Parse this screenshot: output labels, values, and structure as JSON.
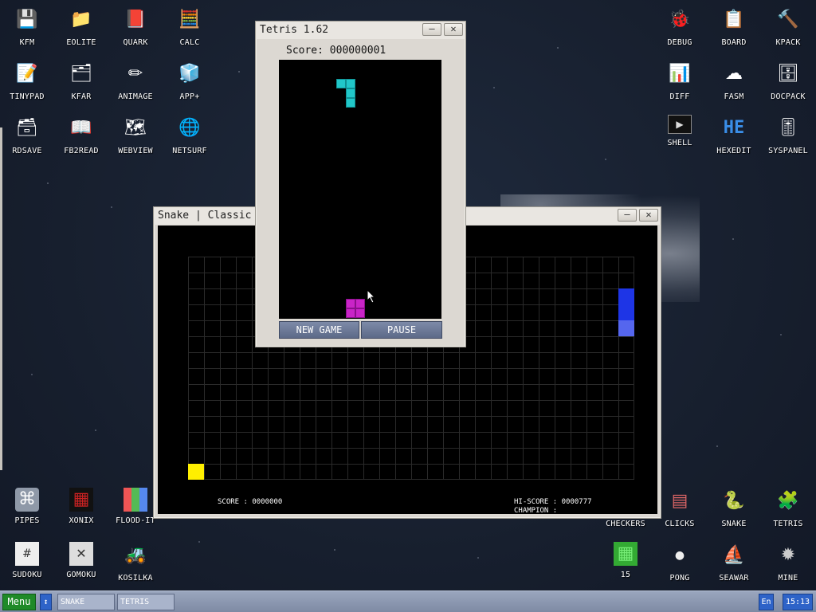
{
  "desktop_icons": [
    {
      "label": "KFM",
      "icon": "floppy-icon",
      "glyph": "💾"
    },
    {
      "label": "EOLITE",
      "icon": "folder-icon",
      "glyph": "📁"
    },
    {
      "label": "QUARK",
      "icon": "notebook-icon",
      "glyph": "📕"
    },
    {
      "label": "CALC",
      "icon": "calculator-icon",
      "glyph": "🧮"
    },
    {
      "label": "TINYPAD",
      "icon": "notepad-icon",
      "glyph": "📝"
    },
    {
      "label": "KFAR",
      "icon": "file-manager-icon",
      "glyph": "🗂"
    },
    {
      "label": "ANIMAGE",
      "icon": "brush-icon",
      "glyph": "✏"
    },
    {
      "label": "APP+",
      "icon": "cube-icon",
      "glyph": "🧊"
    },
    {
      "label": "RDSAVE",
      "icon": "disk-save-icon",
      "glyph": "🗃"
    },
    {
      "label": "FB2READ",
      "icon": "book-icon",
      "glyph": "📖"
    },
    {
      "label": "WEBVIEW",
      "icon": "map-icon",
      "glyph": "🗺"
    },
    {
      "label": "NETSURF",
      "icon": "globe-icon",
      "glyph": "🌐"
    },
    {
      "label": "DEBUG",
      "icon": "bug-icon",
      "glyph": "🐞"
    },
    {
      "label": "BOARD",
      "icon": "board-icon",
      "glyph": "📋"
    },
    {
      "label": "KPACK",
      "icon": "hammer-icon",
      "glyph": "🔨"
    },
    {
      "label": "DIFF",
      "icon": "diff-icon",
      "glyph": "📊"
    },
    {
      "label": "FASM",
      "icon": "cloud-icon",
      "glyph": "☁"
    },
    {
      "label": "DOCPACK",
      "icon": "cabinet-icon",
      "glyph": "🗄"
    },
    {
      "label": "SHELL",
      "icon": "terminal-icon",
      "glyph": "▶"
    },
    {
      "label": "HEXEDIT",
      "icon": "hex-icon",
      "glyph": "HE"
    },
    {
      "label": "SYSPANEL",
      "icon": "sliders-icon",
      "glyph": "🎚"
    },
    {
      "label": "PIPES",
      "icon": "pipes-icon",
      "glyph": "⌘"
    },
    {
      "label": "XONIX",
      "icon": "xonix-icon",
      "glyph": "▦"
    },
    {
      "label": "FLOOD-IT",
      "icon": "flood-icon",
      "glyph": "▩"
    },
    {
      "label": "CHECKERS",
      "icon": "checkers-icon",
      "glyph": "♟"
    },
    {
      "label": "CLICKS",
      "icon": "blocks-icon",
      "glyph": "▤"
    },
    {
      "label": "SNAKE",
      "icon": "snake-icon",
      "glyph": "🐍"
    },
    {
      "label": "TETRIS",
      "icon": "tetris-icon",
      "glyph": "🧩"
    },
    {
      "label": "SUDOKU",
      "icon": "sudoku-icon",
      "glyph": "#"
    },
    {
      "label": "GOMOKU",
      "icon": "gomoku-icon",
      "glyph": "✕"
    },
    {
      "label": "KOSILKA",
      "icon": "mower-icon",
      "glyph": "🚜"
    },
    {
      "label": "15",
      "icon": "fifteen-icon",
      "glyph": "▦"
    },
    {
      "label": "PONG",
      "icon": "pong-icon",
      "glyph": "●"
    },
    {
      "label": "SEAWAR",
      "icon": "ship-icon",
      "glyph": "⛵"
    },
    {
      "label": "MINE",
      "icon": "mine-icon",
      "glyph": "✹"
    }
  ],
  "snake": {
    "title": "Snake | Classic",
    "score": "SCORE : 0000000",
    "hi_score": "HI-SCORE : 0000777",
    "champion": "CHAMPION :",
    "minimize": "–",
    "close": "✕"
  },
  "tetris": {
    "title": "Tetris 1.62",
    "score": "Score: 000000001",
    "new_game": "NEW GAME",
    "pause": "PAUSE",
    "minimize": "–",
    "close": "✕"
  },
  "taskbar": {
    "menu": "Menu",
    "arrows": "↕",
    "tasks": [
      "SNAKE",
      "TETRIS"
    ],
    "lang": "En",
    "clock": "15:13"
  }
}
